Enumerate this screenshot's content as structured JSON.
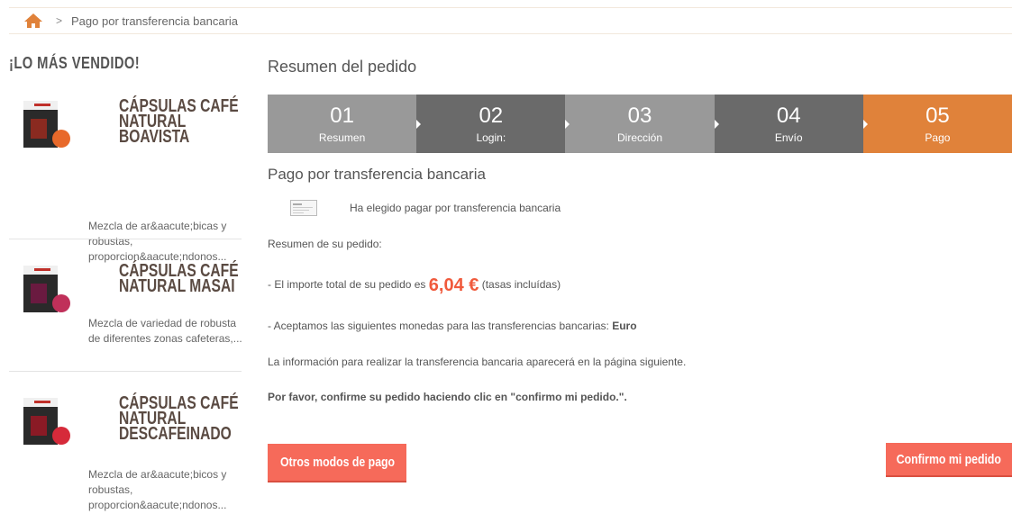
{
  "breadcrumb": {
    "separator": ">",
    "current": "Pago por transferencia bancaria"
  },
  "sidebar": {
    "title": "¡LO MÁS VENDIDO!",
    "products": [
      {
        "name": "CÁPSULAS CAFÉ NATURAL BOAVISTA",
        "description": "Mezcla de ar&aacute;bicas y robustas, proporcion&aacute;ndonos...",
        "capsule_color": "#e8692a"
      },
      {
        "name": "CÁPSULAS CAFÉ NATURAL MASAI",
        "description": "Mezcla de variedad de robusta de diferentes zonas cafeteras,...",
        "capsule_color": "#c0305a"
      },
      {
        "name": "CÁPSULAS CAFÉ NATURAL DESCAFEINADO",
        "description": "Mezcla de ar&aacute;bicos y robustas, proporcion&aacute;ndonos...",
        "capsule_color": "#d62a3a"
      }
    ]
  },
  "main": {
    "title": "Resumen del pedido",
    "steps": [
      {
        "num": "01",
        "label": "Resumen"
      },
      {
        "num": "02",
        "label": "Login:"
      },
      {
        "num": "03",
        "label": "Dirección"
      },
      {
        "num": "04",
        "label": "Envío"
      },
      {
        "num": "05",
        "label": "Pago"
      }
    ],
    "payment_title": "Pago por transferencia bancaria",
    "chosen_text": "Ha elegido pagar por transferencia bancaria",
    "summary_label": "Resumen de su pedido:",
    "total_prefix": "- El importe total de su pedido es ",
    "total_amount": "6,04 €",
    "total_suffix": " (tasas incluídas)",
    "currency_prefix": "- Aceptamos las siguientes monedas para las transferencias bancarias: ",
    "currency": "Euro",
    "info_text": "La información para realizar la transferencia bancaria aparecerá en la página siguiente.",
    "confirm_text": "Por favor, confirme su pedido haciendo clic en \"confirmo mi pedido.\".",
    "other_button": "Otros modos de pago",
    "confirm_button": "Confirmo mi pedido"
  },
  "colors": {
    "accent": "#e0823a",
    "button": "#f66a5a",
    "price": "#f05a3c"
  }
}
